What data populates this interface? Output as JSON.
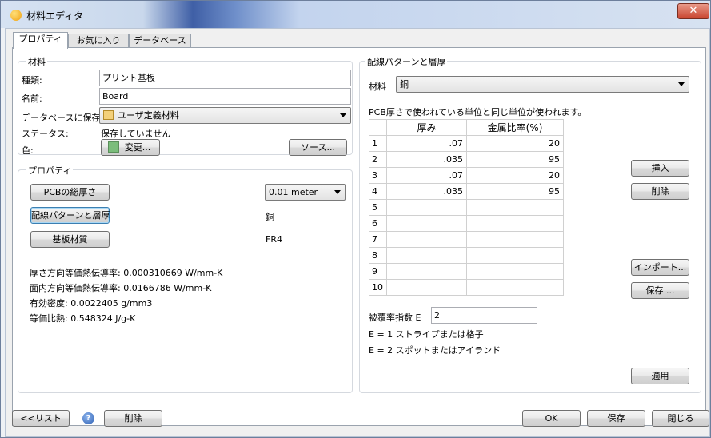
{
  "window": {
    "title": "材料エディタ",
    "close_glyph": "✕"
  },
  "tabs": [
    "プロパティ",
    "お気に入り",
    "データベース"
  ],
  "material": {
    "group_label": "材料",
    "type_label": "種類:",
    "type_value": "プリント基板",
    "name_label": "名前:",
    "name_value": "Board",
    "db_label": "データベースに保存:",
    "db_value": "ユーザ定義材料",
    "status_label": "ステータス:",
    "status_value": "保存していません",
    "color_label": "色:",
    "color_button": "変更...",
    "source_button": "ソース...",
    "swatch_color": "#7bbd7b"
  },
  "properties": {
    "group_label": "プロパティ",
    "pcb_thickness_button": "PCBの総厚さ",
    "pcb_thickness_value": "0.01 meter",
    "trace_layer_button": "配線パターンと層厚",
    "trace_layer_value": "銅",
    "substrate_button": "基板材質",
    "substrate_value": "FR4",
    "stats": [
      {
        "label": "厚さ方向等価熱伝導率:",
        "value": "0.000310669 W/mm-K"
      },
      {
        "label": "面内方向等価熱伝導率:",
        "value": "0.0166786 W/mm-K"
      },
      {
        "label": "有効密度:",
        "value": "0.0022405 g/mm3"
      },
      {
        "label": "等価比熱:",
        "value": "0.548324 J/g-K"
      }
    ]
  },
  "trace": {
    "group_label": "配線パターンと層厚",
    "material_label": "材料",
    "material_value": "銅",
    "note": "PCB厚さで使われている単位と同じ単位が使われます。",
    "columns": [
      "厚み",
      "金属比率(%)"
    ],
    "rows": [
      {
        "n": "1",
        "thickness": ".07",
        "ratio": "20"
      },
      {
        "n": "2",
        "thickness": ".035",
        "ratio": "95"
      },
      {
        "n": "3",
        "thickness": ".07",
        "ratio": "20"
      },
      {
        "n": "4",
        "thickness": ".035",
        "ratio": "95"
      },
      {
        "n": "5",
        "thickness": "",
        "ratio": ""
      },
      {
        "n": "6",
        "thickness": "",
        "ratio": ""
      },
      {
        "n": "7",
        "thickness": "",
        "ratio": ""
      },
      {
        "n": "8",
        "thickness": "",
        "ratio": ""
      },
      {
        "n": "9",
        "thickness": "",
        "ratio": ""
      },
      {
        "n": "10",
        "thickness": "",
        "ratio": ""
      }
    ],
    "insert_button": "挿入",
    "delete_button": "削除",
    "import_button": "インポート...",
    "save_button": "保存 ...",
    "coverage_label": "被覆率指数 E",
    "coverage_value": "2",
    "e1_note": "E = 1 ストライプまたは格子",
    "e2_note": "E = 2 スポットまたはアイランド",
    "apply_button": "適用"
  },
  "footer": {
    "list_button": "<<リスト",
    "delete_button": "削除",
    "ok_button": "OK",
    "save_button": "保存",
    "close_button": "閉じる",
    "help_glyph": "?"
  }
}
